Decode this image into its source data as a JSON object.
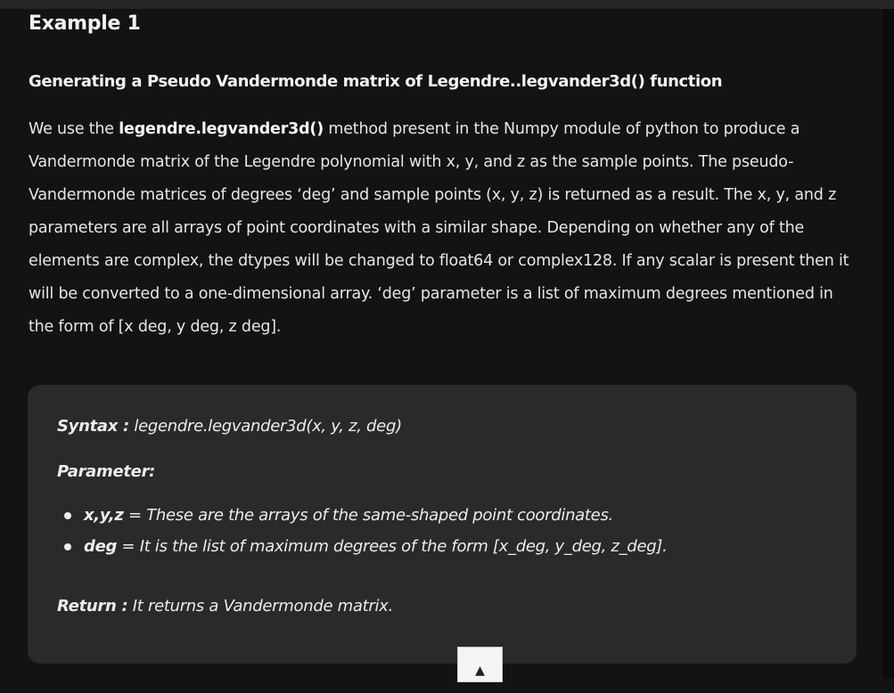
{
  "example": {
    "title": "Example 1"
  },
  "section": {
    "heading": "Generating a Pseudo Vandermonde matrix of Legendre..legvander3d() function"
  },
  "description": {
    "intro": "We use the ",
    "method_name": "legendre.legvander3d()",
    "body": " method present in the Numpy module of python to produce a Vandermonde matrix of the Legendre polynomial with x, y, and z as the sample points. The pseudo-Vandermonde matrices of degrees ‘deg’ and sample points  (x, y, z) is returned as a result. The x, y, and z parameters are all arrays of point coordinates with a similar shape. Depending on whether any of the elements are complex, the dtypes will be changed to float64 or complex128. If any scalar is present then it will be converted to a one-dimensional array. ‘deg’ parameter is a list of maximum degrees mentioned in the form of  [x deg, y deg, z deg]."
  },
  "syntax_card": {
    "syntax_label": "Syntax :",
    "syntax_value": " legendre.legvander3d(x, y, z, deg)",
    "parameter_label": "Parameter:",
    "params": [
      {
        "name": "x,y,z",
        "desc": " = These are the arrays of the same-shaped point coordinates."
      },
      {
        "name": "deg",
        "desc": " = It is the list of maximum degrees of the form [x_deg, y_deg, z_deg]."
      }
    ],
    "return_label": "Return :",
    "return_value": " It returns a Vandermonde matrix."
  },
  "scroll_top_button": {
    "icon": "up-arrow-icon",
    "glyph": "▲"
  },
  "colors": {
    "background": "#131313",
    "card": "#2a2a2c",
    "text": "#e8e8e8"
  }
}
